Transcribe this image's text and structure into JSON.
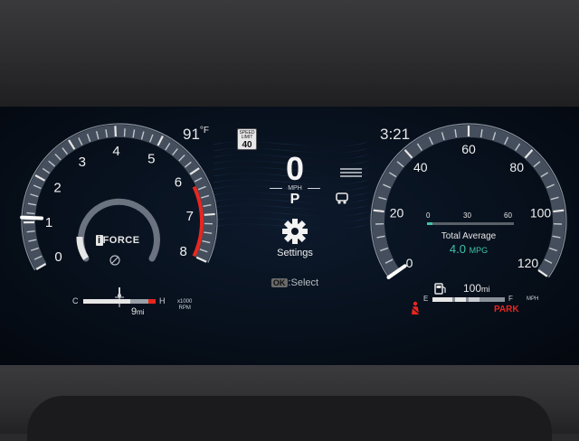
{
  "status": {
    "temperature": "91",
    "temperature_unit": "°F",
    "clock": "3:21",
    "speed_limit_label": "SPEED LIMIT",
    "speed_limit_value": "40"
  },
  "tachometer": {
    "unit_line1": "x1000",
    "unit_line2": "RPM",
    "ticks": [
      "0",
      "1",
      "2",
      "3",
      "4",
      "5",
      "6",
      "7",
      "8"
    ],
    "needle_value": 1.1,
    "redline_from": 6.3,
    "logo_prefix": "i",
    "logo_text": "FORCE",
    "temp_cold": "C",
    "temp_hot": "H",
    "odometer_value": "9",
    "odometer_unit": "mi",
    "redline_color": "#e8261f"
  },
  "center": {
    "speed": "0",
    "speed_unit": "MPH",
    "gear": "P",
    "settings_label": "Settings",
    "select_key": "OK",
    "select_text": ":Select",
    "settings_icon": "gear-icon"
  },
  "speedometer": {
    "ticks": [
      "0",
      "20",
      "40",
      "60",
      "80",
      "100",
      "120"
    ],
    "unit": "MPH",
    "needle_value": 0,
    "max_value": 120,
    "economy_scale": [
      "0",
      "30",
      "60"
    ],
    "economy_title": "Total Average",
    "economy_value": "4.0",
    "economy_unit": "MPG",
    "fuel_empty": "E",
    "fuel_full": "F",
    "range_value": "100",
    "range_unit": "mi",
    "park_label": "PARK",
    "accent_color": "#3ec3a8"
  }
}
